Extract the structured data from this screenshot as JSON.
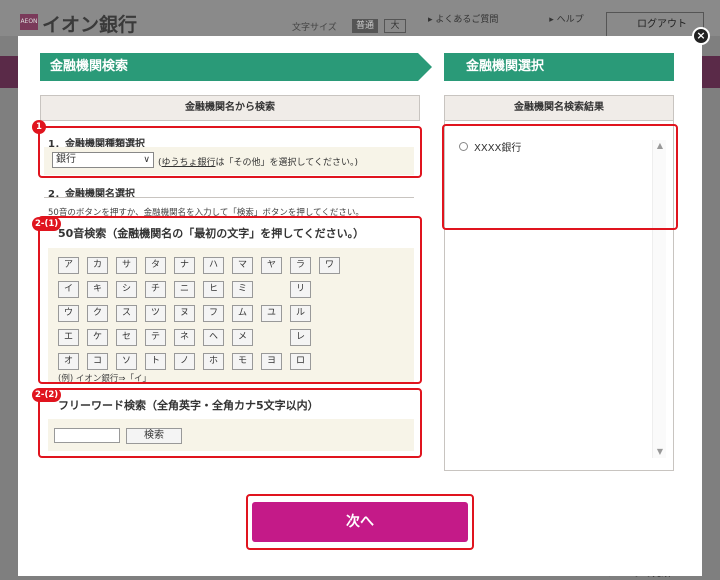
{
  "background": {
    "logo_mark": "AEON",
    "logo_text": "イオン銀行",
    "font_size_label": "文字サイズ",
    "font_size_standard": "普通",
    "font_size_large": "大",
    "links": [
      "よくあるご質問",
      "ヘルプ"
    ],
    "logout_label": "ログアウト",
    "page_top_label": "ページの先頭へ"
  },
  "modal": {
    "step1_title": "金融機関検索",
    "step2_title": "金融機関選択",
    "left_panel_title": "金融機関名から検索",
    "right_panel_title": "金融機関名検索結果",
    "section1_title": "1．金融機関種類選択",
    "bank_type_value": "銀行",
    "type_note_prefix": "(",
    "type_note_link": "ゆうちょ銀行",
    "type_note_suffix": "は「その他」を選択してください。)",
    "section2_title": "2．金融機関名選択",
    "help_text": "50音のボタンを押すか、金融機関名を入力して「検索」ボタンを押してください。",
    "kana_title": "50音検索（金融機関名の「最初の文字」を押してください。）",
    "kana_example": "(例) イオン銀行⇒「イ」",
    "free_title": "フリーワード検索（全角英字・全角カナ5文字以内）",
    "search_button": "検索",
    "result_item": "XXXX銀行",
    "next_button": "次へ",
    "close_label": "×"
  },
  "kana_rows": [
    [
      "ア",
      "カ",
      "サ",
      "タ",
      "ナ",
      "ハ",
      "マ",
      "ヤ",
      "ラ",
      "ワ"
    ],
    [
      "イ",
      "キ",
      "シ",
      "チ",
      "ニ",
      "ヒ",
      "ミ",
      "",
      "リ",
      ""
    ],
    [
      "ウ",
      "ク",
      "ス",
      "ツ",
      "ヌ",
      "フ",
      "ム",
      "ユ",
      "ル",
      ""
    ],
    [
      "エ",
      "ケ",
      "セ",
      "テ",
      "ネ",
      "ヘ",
      "メ",
      "",
      "レ",
      ""
    ],
    [
      "オ",
      "コ",
      "ソ",
      "ト",
      "ノ",
      "ホ",
      "モ",
      "ヨ",
      "ロ",
      ""
    ]
  ],
  "annotations": {
    "badge1": "1",
    "badge2_1": "2-(1)",
    "badge2_2": "2-(2)",
    "accent_color": "#e0141e"
  },
  "colors": {
    "step_green": "#2a9a78",
    "next_magenta": "#c41a88"
  }
}
